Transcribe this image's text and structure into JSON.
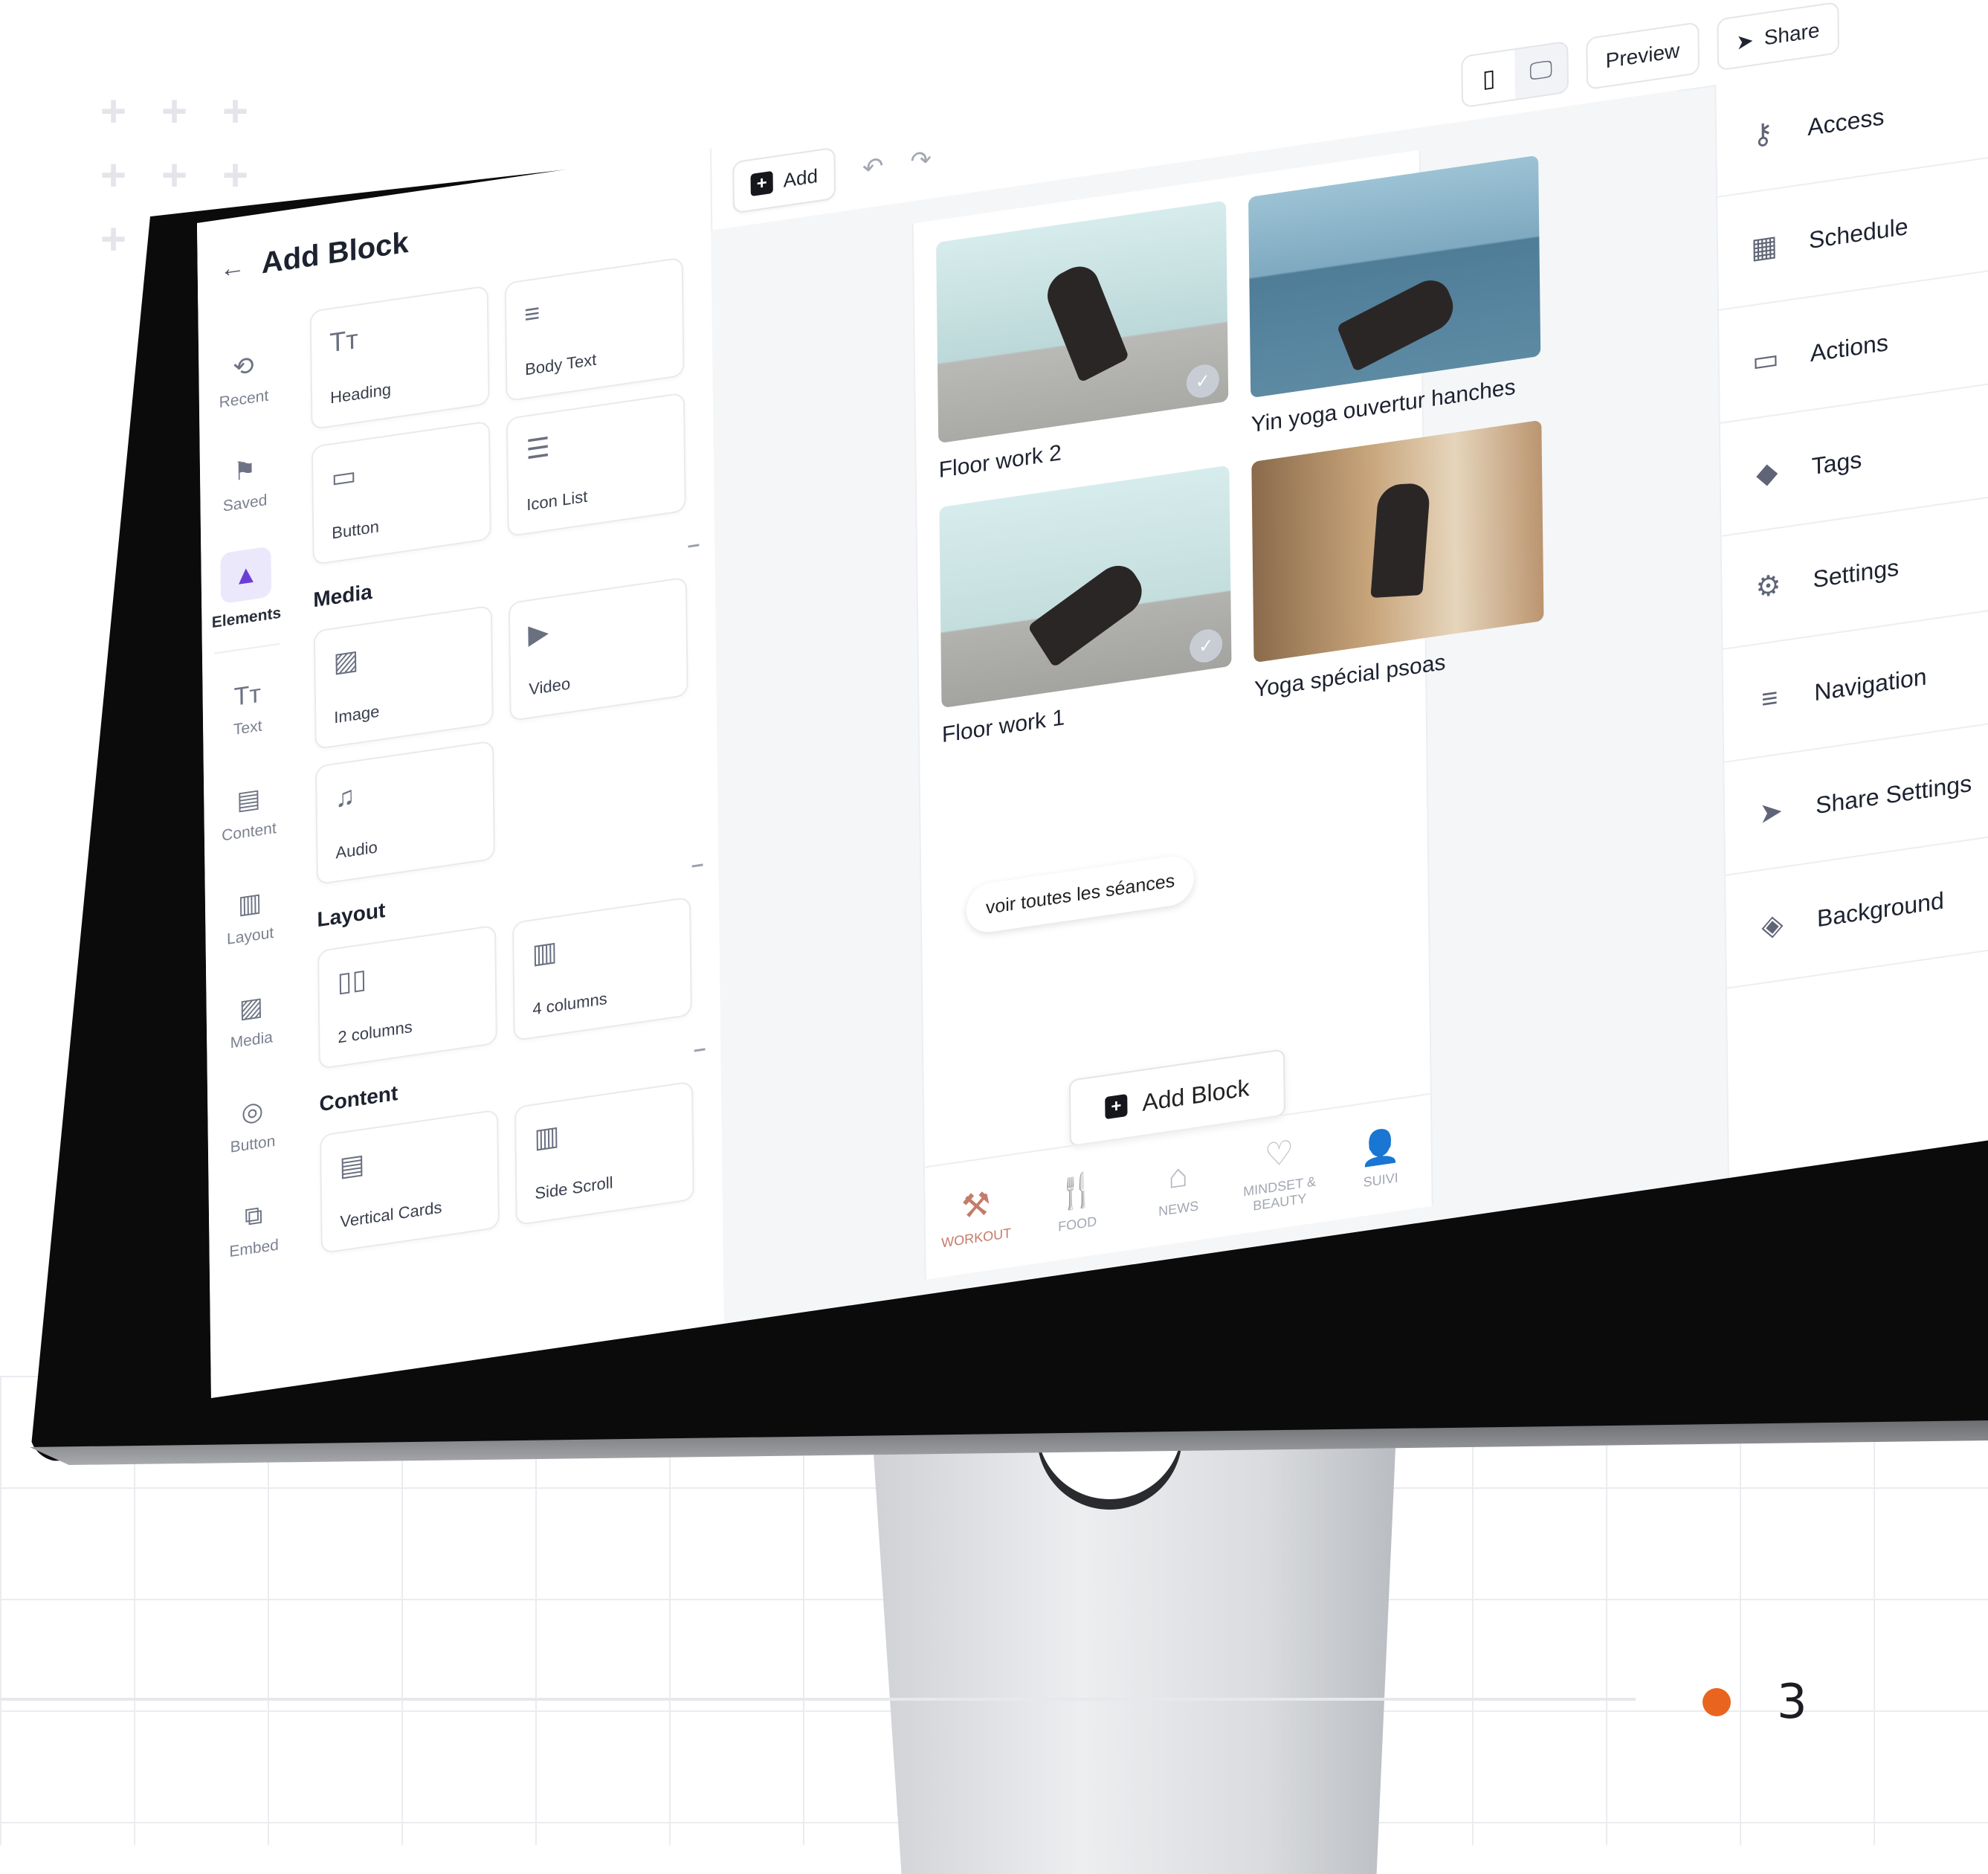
{
  "left_panel": {
    "title": "Add Block",
    "rail": [
      {
        "label": "Recent",
        "icon": "history-icon"
      },
      {
        "label": "Saved",
        "icon": "bookmark-icon"
      },
      {
        "label": "Elements",
        "icon": "shapes-icon",
        "active": true
      },
      {
        "label": "Text",
        "icon": "text-icon"
      },
      {
        "label": "Content",
        "icon": "content-icon"
      },
      {
        "label": "Layout",
        "icon": "layout-icon"
      },
      {
        "label": "Media",
        "icon": "image-icon"
      },
      {
        "label": "Button",
        "icon": "cursor-icon"
      },
      {
        "label": "Embed",
        "icon": "embed-icon"
      }
    ],
    "text_blocks": [
      {
        "label": "Heading",
        "icon": "text-icon"
      },
      {
        "label": "Body Text",
        "icon": "lines-icon"
      },
      {
        "label": "Button",
        "icon": "button-icon"
      },
      {
        "label": "Icon List",
        "icon": "list-icon"
      }
    ],
    "sections": [
      {
        "title": "Media",
        "items": [
          {
            "label": "Image"
          },
          {
            "label": "Video"
          },
          {
            "label": "Audio"
          }
        ]
      },
      {
        "title": "Layout",
        "items": [
          {
            "label": "2 columns"
          },
          {
            "label": "4 columns"
          }
        ]
      },
      {
        "title": "Content",
        "items": [
          {
            "label": "Vertical Cards"
          },
          {
            "label": "Side Scroll"
          }
        ]
      }
    ]
  },
  "toolbar": {
    "add_label": "Add",
    "preview_label": "Preview",
    "share_label": "Share"
  },
  "canvas": {
    "cards": [
      {
        "title": "Floor work 2"
      },
      {
        "title": "Yin yoga ouvertur hanches"
      },
      {
        "title": "Floor work 1"
      },
      {
        "title": "Yoga spécial psoas"
      }
    ],
    "see_all_label": "voir toutes les séances",
    "add_block_label": "Add Block",
    "tabs": [
      {
        "label": "WORKOUT",
        "active": true
      },
      {
        "label": "FOOD"
      },
      {
        "label": "NEWS"
      },
      {
        "label": "MINDSET & BEAUTY"
      },
      {
        "label": "SUIVI"
      }
    ]
  },
  "right_panel": {
    "items": [
      {
        "label": "Access",
        "icon": "key-icon"
      },
      {
        "label": "Schedule",
        "icon": "calendar-icon"
      },
      {
        "label": "Actions",
        "icon": "action-icon"
      },
      {
        "label": "Tags",
        "icon": "tag-icon"
      },
      {
        "label": "Settings",
        "icon": "gear-icon"
      },
      {
        "label": "Navigation",
        "icon": "menu-icon"
      },
      {
        "label": "Share Settings",
        "icon": "send-icon"
      },
      {
        "label": "Background",
        "icon": "paint-bucket-icon"
      }
    ]
  },
  "slide": {
    "page_number": "3",
    "accent": "#e9651f"
  }
}
